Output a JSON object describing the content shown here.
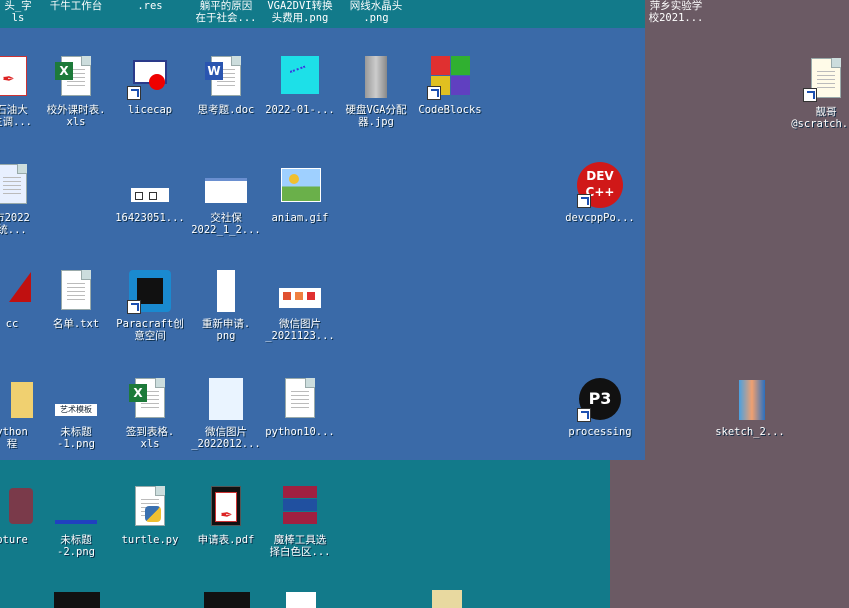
{
  "top_labels": [
    {
      "text": "头_字\nls"
    },
    {
      "text": "千牛工作台"
    },
    {
      "text": ".res"
    },
    {
      "text": "躺平的原因\n在于社会..."
    },
    {
      "text": "VGA2DVI转换\n头费用.png"
    },
    {
      "text": "网线水晶头\n.png"
    },
    {
      "text": "萍乡实验学\n校2021..."
    }
  ],
  "icons": [
    {
      "label": "石油大\n生调..."
    },
    {
      "label": "校外课时表.\nxls"
    },
    {
      "label": "licecap"
    },
    {
      "label": "思考题.doc"
    },
    {
      "label": "2022-01-..."
    },
    {
      "label": "硬盘VGA分配\n器.jpg"
    },
    {
      "label": "CodeBlocks"
    },
    {
      "label": "靓哥\n@scratch..."
    },
    {
      "label": "市2022\n统..."
    },
    {
      "label": "16423051..."
    },
    {
      "label": "交社保\n2022_1_2..."
    },
    {
      "label": "aniam.gif"
    },
    {
      "label": "devcppPo..."
    },
    {
      "label": "cc"
    },
    {
      "label": "名单.txt"
    },
    {
      "label": "Paracraft创\n意空间"
    },
    {
      "label": "重新申请.\npng"
    },
    {
      "label": "微信图片\n_2021123..."
    },
    {
      "label": "ython\n程"
    },
    {
      "label": "未标题\n-1.png"
    },
    {
      "label": "签到表格.\nxls"
    },
    {
      "label": "微信图片\n_2022012..."
    },
    {
      "label": "python10..."
    },
    {
      "label": "processing"
    },
    {
      "label": "sketch_2..."
    },
    {
      "label": "pture"
    },
    {
      "label": "未标题\n-2.png"
    },
    {
      "label": "turtle.py"
    },
    {
      "label": "申请表.pdf"
    },
    {
      "label": "魔棒工具选\n择白色区..."
    }
  ],
  "icon_art": {
    "art_text_banner": "艺术模板",
    "dev_cpp_text": "DEV\nC++",
    "processing_text": "P3"
  }
}
